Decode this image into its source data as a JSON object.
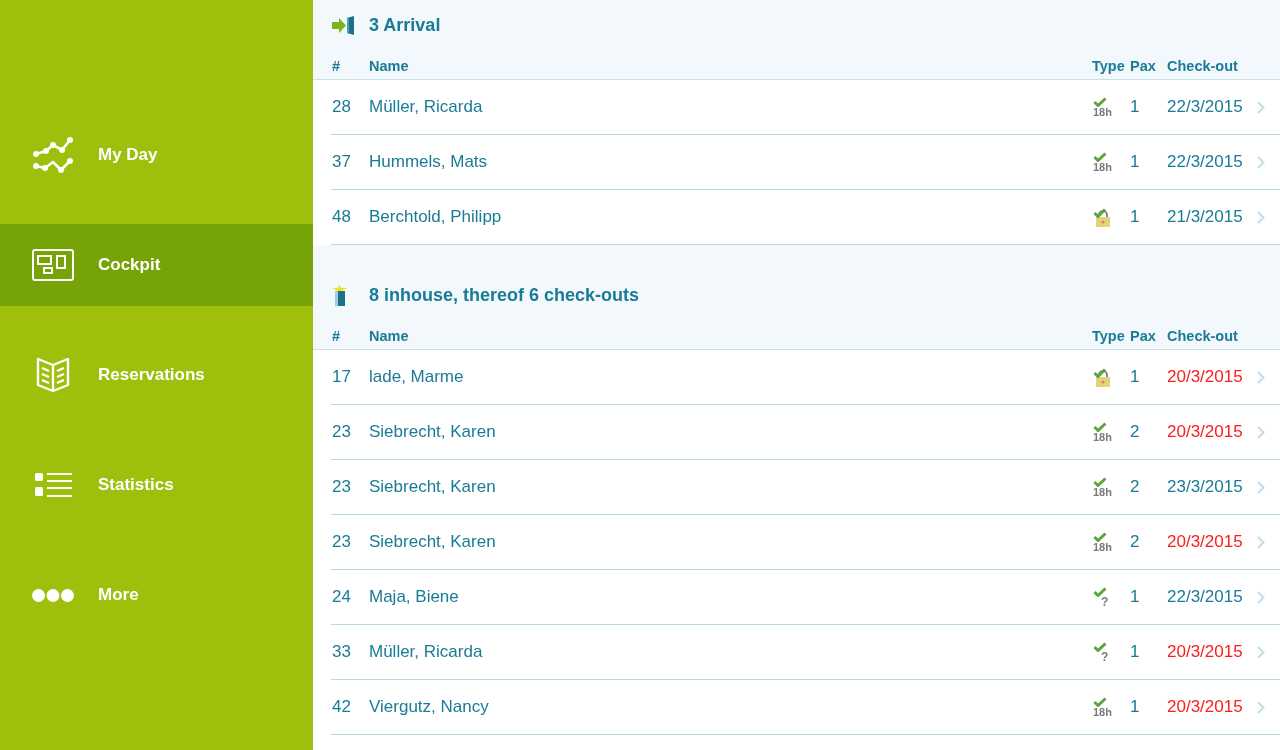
{
  "sidebar": {
    "items": [
      {
        "kind": "chart",
        "label": "My Day",
        "selected": false
      },
      {
        "kind": "cockpit",
        "label": "Cockpit",
        "selected": true
      },
      {
        "kind": "book",
        "label": "Reservations",
        "selected": false
      },
      {
        "kind": "list",
        "label": "Statistics",
        "selected": false
      },
      {
        "kind": "more",
        "label": "More",
        "selected": false
      }
    ]
  },
  "sections": [
    {
      "kind": "arrival",
      "title": "3 Arrival",
      "columns": [
        "#",
        "Name",
        "Type",
        "Pax",
        "Check-out"
      ],
      "rows": [
        {
          "number": "28",
          "name": "Müller, Ricarda",
          "type": {
            "kind": "hours",
            "label": "18h"
          },
          "pax": "1",
          "check_out": "22/3/2015",
          "due_today": false
        },
        {
          "number": "37",
          "name": "Hummels, Mats",
          "type": {
            "kind": "hours",
            "label": "18h"
          },
          "pax": "1",
          "check_out": "22/3/2015",
          "due_today": false
        },
        {
          "number": "48",
          "name": "Berchtold, Philipp",
          "type": {
            "kind": "lock"
          },
          "pax": "1",
          "check_out": "21/3/2015",
          "due_today": false
        }
      ]
    },
    {
      "kind": "inhouse",
      "title": "8 inhouse, thereof 6 check-outs",
      "columns": [
        "#",
        "Name",
        "Type",
        "Pax",
        "Check-out"
      ],
      "rows": [
        {
          "number": "17",
          "name": "lade, Marme",
          "type": {
            "kind": "lock"
          },
          "pax": "1",
          "check_out": "20/3/2015",
          "due_today": true
        },
        {
          "number": "23",
          "name": "Siebrecht, Karen",
          "type": {
            "kind": "hours",
            "label": "18h"
          },
          "pax": "2",
          "check_out": "20/3/2015",
          "due_today": true
        },
        {
          "number": "23",
          "name": "Siebrecht, Karen",
          "type": {
            "kind": "hours",
            "label": "18h"
          },
          "pax": "2",
          "check_out": "23/3/2015",
          "due_today": false
        },
        {
          "number": "23",
          "name": "Siebrecht, Karen",
          "type": {
            "kind": "hours",
            "label": "18h"
          },
          "pax": "2",
          "check_out": "20/3/2015",
          "due_today": true
        },
        {
          "number": "24",
          "name": "Maja, Biene",
          "type": {
            "kind": "question",
            "label": "?"
          },
          "pax": "1",
          "check_out": "22/3/2015",
          "due_today": false
        },
        {
          "number": "33",
          "name": "Müller, Ricarda",
          "type": {
            "kind": "question",
            "label": "?"
          },
          "pax": "1",
          "check_out": "20/3/2015",
          "due_today": true
        },
        {
          "number": "42",
          "name": "Viergutz, Nancy",
          "type": {
            "kind": "hours",
            "label": "18h"
          },
          "pax": "1",
          "check_out": "20/3/2015",
          "due_today": true
        }
      ]
    }
  ]
}
